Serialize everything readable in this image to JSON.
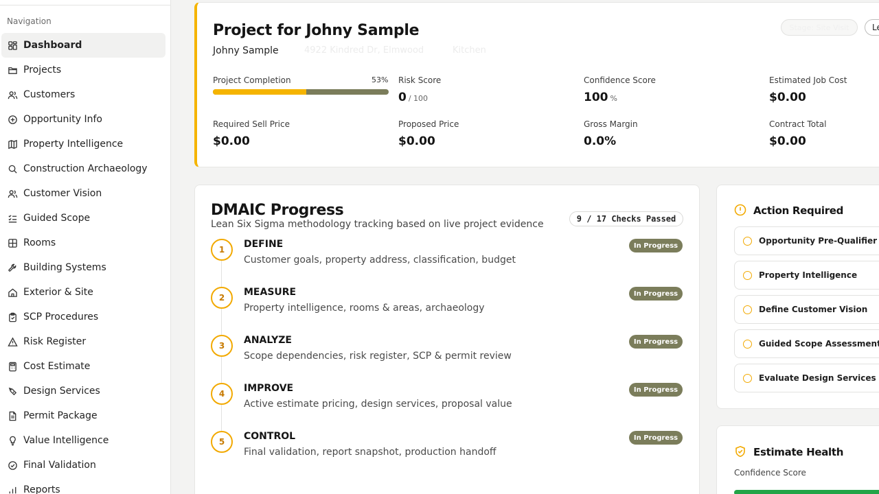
{
  "sidebar": {
    "heading": "Navigation",
    "items": [
      {
        "label": "Dashboard",
        "icon": "dashboard-icon",
        "active": true
      },
      {
        "label": "Projects",
        "icon": "folder-icon"
      },
      {
        "label": "Customers",
        "icon": "users-icon"
      },
      {
        "label": "Opportunity Info",
        "icon": "plus-circle-icon"
      },
      {
        "label": "Property Intelligence",
        "icon": "map-icon"
      },
      {
        "label": "Construction Archaeology",
        "icon": "search-icon"
      },
      {
        "label": "Customer Vision",
        "icon": "users-icon"
      },
      {
        "label": "Guided Scope",
        "icon": "list-check-icon"
      },
      {
        "label": "Rooms",
        "icon": "grid-icon"
      },
      {
        "label": "Building Systems",
        "icon": "wrench-icon"
      },
      {
        "label": "Exterior & Site",
        "icon": "home-icon"
      },
      {
        "label": "SCP Procedures",
        "icon": "clipboard-icon"
      },
      {
        "label": "Risk Register",
        "icon": "warning-icon"
      },
      {
        "label": "Cost Estimate",
        "icon": "calculator-icon"
      },
      {
        "label": "Design Services",
        "icon": "brush-icon"
      },
      {
        "label": "Permit Package",
        "icon": "document-icon"
      },
      {
        "label": "Value Intelligence",
        "icon": "lightbulb-icon"
      },
      {
        "label": "Final Validation",
        "icon": "check-circle-icon"
      },
      {
        "label": "Reports",
        "icon": "bar-chart-icon"
      }
    ]
  },
  "project": {
    "title": "Project for Johny Sample",
    "client": "Johny Sample",
    "faded_address": "4922 Kindred Dr, Elmwood",
    "faded_note": "Kitchen",
    "stage_badge": "Stage: Site Visit",
    "lead_badge": "Lead",
    "completion_label": "Project Completion",
    "completion_pct_text": "53%",
    "completion_fraction": 0.53,
    "metrics": {
      "risk_label": "Risk Score",
      "risk_value": "0",
      "risk_unit": "/ 100",
      "confidence_label": "Confidence Score",
      "confidence_value": "100",
      "confidence_unit": "%",
      "job_cost_label": "Estimated Job Cost",
      "job_cost_value": "$0.00",
      "sell_label": "Required Sell Price",
      "sell_value": "$0.00",
      "proposed_label": "Proposed Price",
      "proposed_value": "$0.00",
      "margin_label": "Gross Margin",
      "margin_value": "0.0%",
      "contract_label": "Contract Total",
      "contract_value": "$0.00"
    }
  },
  "dmaic": {
    "title": "DMAIC Progress",
    "subtitle": "Lean Six Sigma methodology tracking based on live project evidence",
    "checks": "9 / 17 Checks Passed",
    "steps": [
      {
        "num": "1",
        "name": "DEFINE",
        "desc": "Customer goals, property address, classification, budget",
        "status": "In Progress"
      },
      {
        "num": "2",
        "name": "MEASURE",
        "desc": "Property intelligence, rooms & areas, archaeology",
        "status": "In Progress"
      },
      {
        "num": "3",
        "name": "ANALYZE",
        "desc": "Scope dependencies, risk register, SCP & permit review",
        "status": "In Progress"
      },
      {
        "num": "4",
        "name": "IMPROVE",
        "desc": "Active estimate pricing, design services, proposal value",
        "status": "In Progress"
      },
      {
        "num": "5",
        "name": "CONTROL",
        "desc": "Final validation, report snapshot, production handoff",
        "status": "In Progress"
      }
    ]
  },
  "actions": {
    "title": "Action Required",
    "items": [
      "Opportunity Pre-Qualifier",
      "Property Intelligence",
      "Define Customer Vision",
      "Guided Scope Assessment",
      "Evaluate Design Services"
    ]
  },
  "health": {
    "title": "Estimate Health",
    "label": "Confidence Score"
  },
  "colors": {
    "accent": "#f5b400",
    "olive": "#7b7d5b",
    "success": "#22a447"
  }
}
